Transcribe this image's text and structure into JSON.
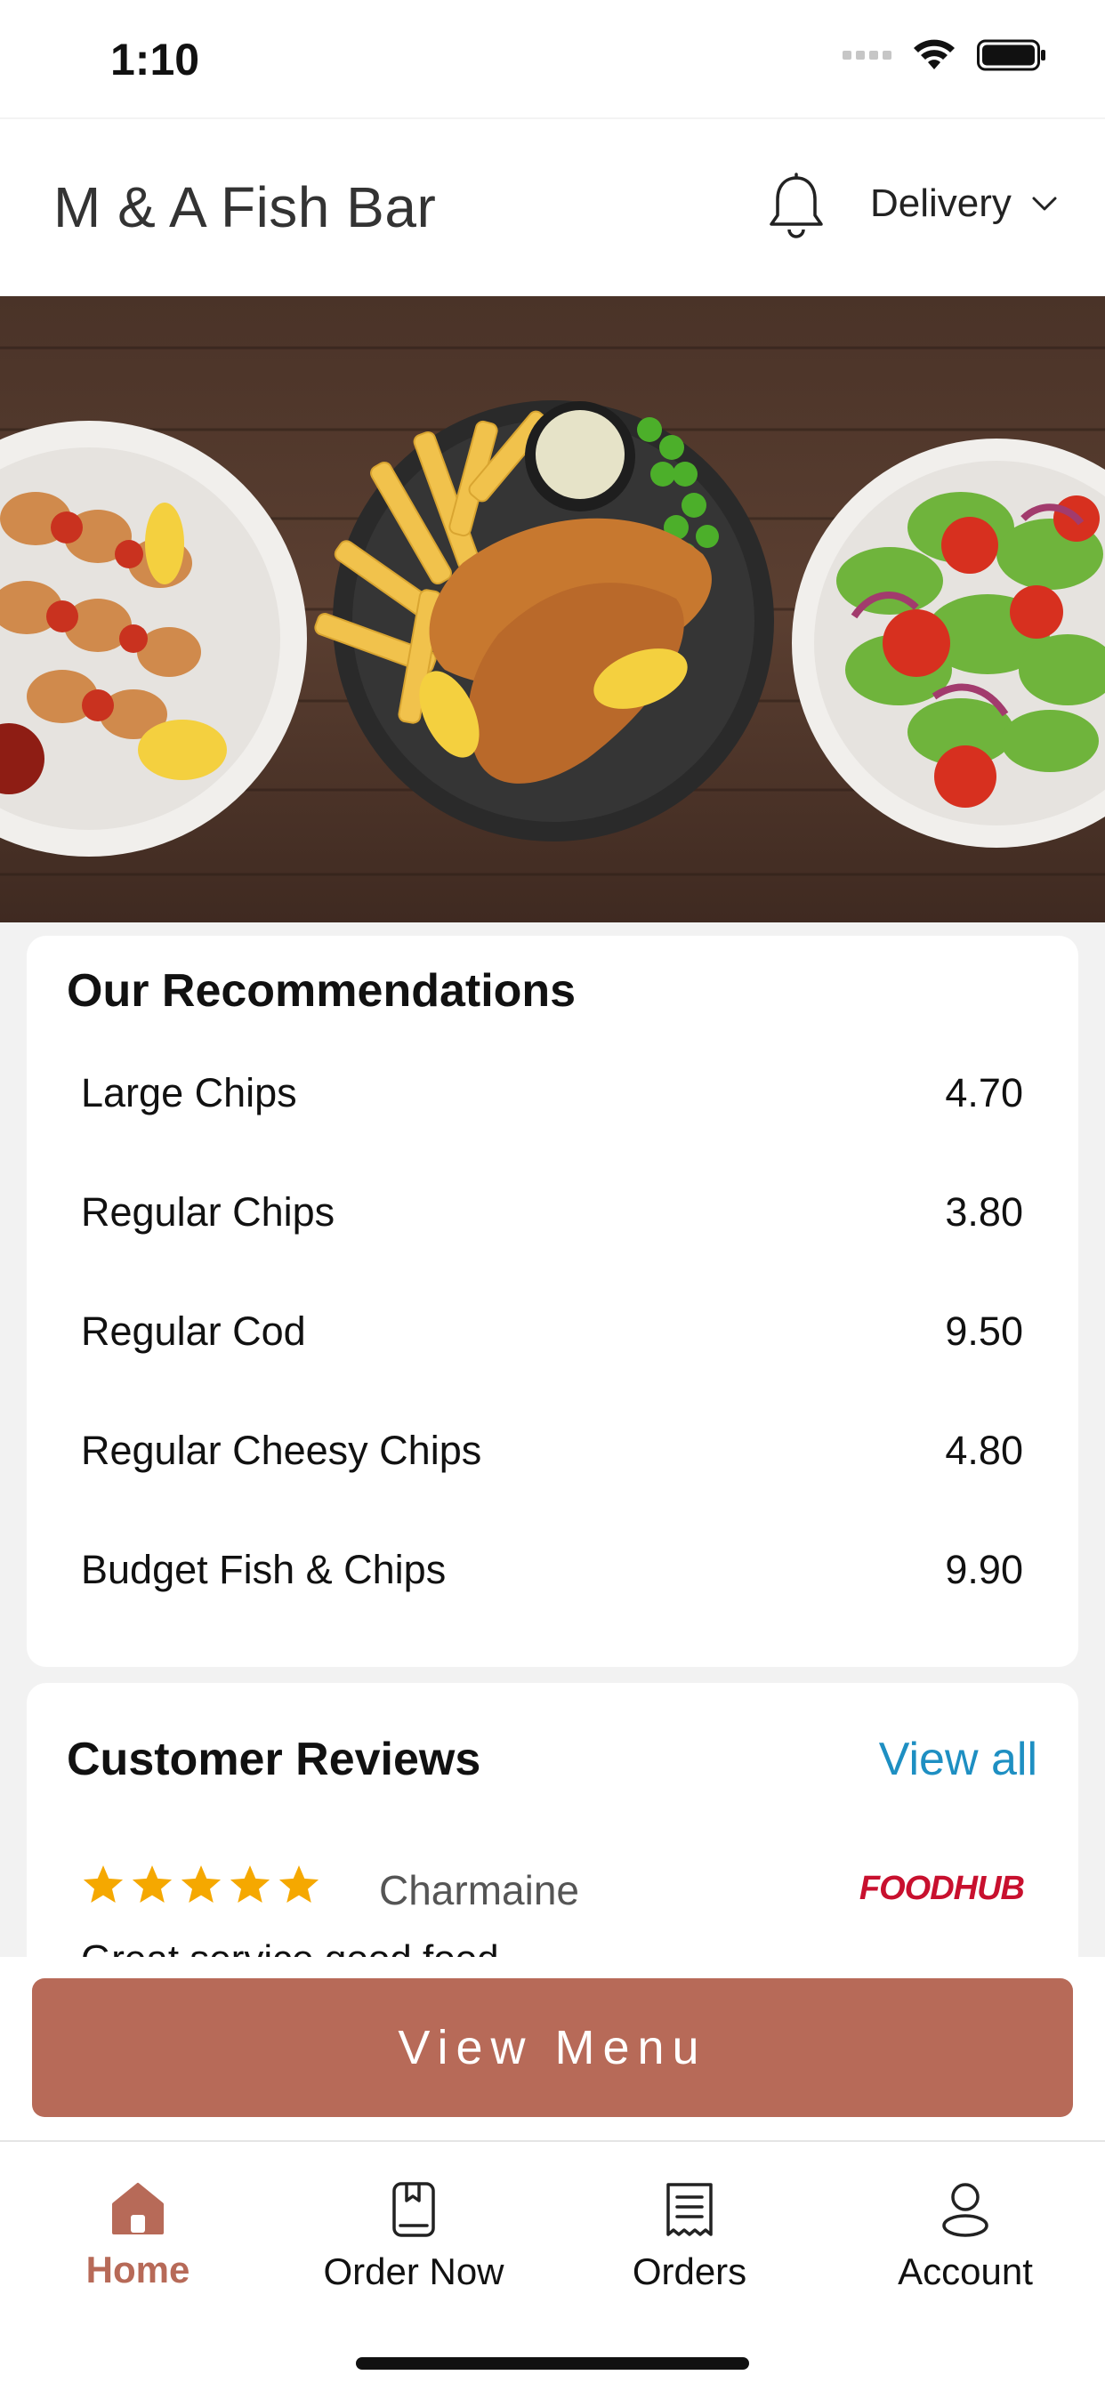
{
  "status_bar": {
    "time": "1:10"
  },
  "header": {
    "title": "M & A Fish Bar",
    "order_mode": "Delivery"
  },
  "recommendations": {
    "title": "Our Recommendations",
    "items": [
      {
        "name": "Large Chips",
        "price": "4.70"
      },
      {
        "name": "Regular Chips",
        "price": "3.80"
      },
      {
        "name": "Regular Cod",
        "price": "9.50"
      },
      {
        "name": "Regular Cheesy Chips",
        "price": "4.80"
      },
      {
        "name": "Budget Fish & Chips",
        "price": "9.90"
      }
    ]
  },
  "reviews": {
    "title": "Customer Reviews",
    "view_all_label": "View all",
    "items": [
      {
        "rating": 5,
        "reviewer": "Charmaine",
        "source": "FOODHUB",
        "text": "Great service good food"
      }
    ]
  },
  "cta": {
    "view_menu_label": "View Menu"
  },
  "tabbar": {
    "items": [
      {
        "label": "Home",
        "icon": "home-icon",
        "active": true
      },
      {
        "label": "Order Now",
        "icon": "order-book-icon",
        "active": false
      },
      {
        "label": "Orders",
        "icon": "receipt-icon",
        "active": false
      },
      {
        "label": "Account",
        "icon": "user-icon",
        "active": false
      }
    ]
  },
  "colors": {
    "accent": "#b76a58",
    "link": "#1e8fc2",
    "star": "#f5a800",
    "foodhub_red": "#c8102e"
  }
}
